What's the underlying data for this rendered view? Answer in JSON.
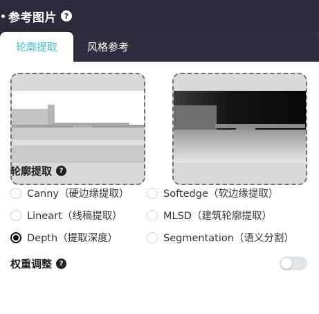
{
  "header": {
    "title": "参考图片"
  },
  "tabs": [
    {
      "label": "轮廓提取",
      "active": true
    },
    {
      "label": "风格参考",
      "active": false
    }
  ],
  "contour": {
    "title": "轮廓提取",
    "options": [
      {
        "label": "Canny（硬边缘提取）",
        "checked": false
      },
      {
        "label": "Softedge（软边缘提取）",
        "checked": false
      },
      {
        "label": "Lineart（线稿提取）",
        "checked": false
      },
      {
        "label": "MLSD（建筑轮廓提取）",
        "checked": false
      },
      {
        "label": "Depth（提取深度）",
        "checked": true
      },
      {
        "label": "Segmentation（语义分割）",
        "checked": false
      }
    ]
  },
  "weight": {
    "title": "权重调整",
    "enabled": false
  },
  "colors": {
    "accent": "#3ec3d0",
    "dark_bg": "#2b2a38"
  },
  "icons": {
    "help": "?"
  }
}
